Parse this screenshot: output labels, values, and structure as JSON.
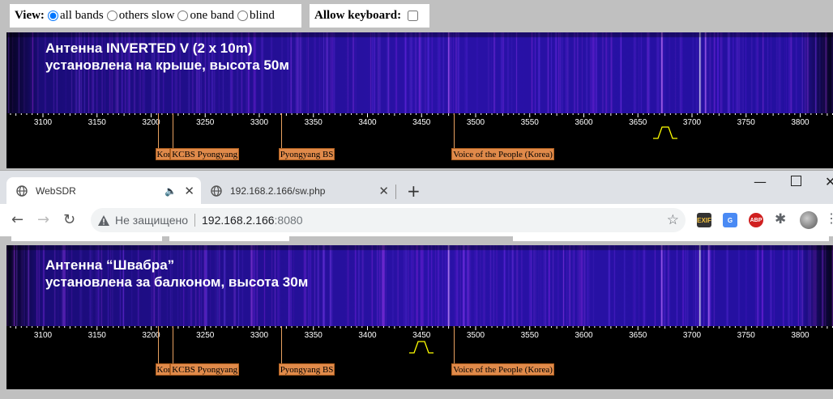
{
  "controls": {
    "view_label": "View:",
    "options": [
      "all bands",
      "others slow",
      "one band",
      "blind"
    ],
    "selected": "all bands",
    "keyboard_label": "Allow keyboard:",
    "keyboard_checked": false
  },
  "panels": [
    {
      "title_line1": "Антенна INVERTED V (2 x 10m)",
      "title_line2": "установлена на крыше, высота 50м",
      "passband_khz": 3675
    },
    {
      "title_line1": "Антенна “Швабра”",
      "title_line2": "установлена за балконом, высота 30м",
      "passband_khz": 3450
    }
  ],
  "scale": {
    "ticks": [
      "3100",
      "3150",
      "3200",
      "3250",
      "3300",
      "3350",
      "3400",
      "3450",
      "3500",
      "3550",
      "3600",
      "3650",
      "3700",
      "3750",
      "3800"
    ]
  },
  "stations": [
    {
      "label": "Kor",
      "khz": 3206
    },
    {
      "label": "KCBS Pyongyang",
      "khz": 3220
    },
    {
      "label": "Pyongyang BS",
      "khz": 3320
    },
    {
      "label": "Voice of the People (Korea)",
      "khz": 3480
    }
  ],
  "browser": {
    "tabs": [
      {
        "title": "WebSDR",
        "active": true
      },
      {
        "title": "192.168.2.166/sw.php",
        "active": false
      }
    ],
    "new_tab": "+",
    "security_text": "Не защищено",
    "url_host": "192.168.2.166",
    "url_port": ":8080",
    "extensions": [
      "EXIF",
      "G",
      "ABP"
    ]
  },
  "colors": {
    "waterfall_bg": "#2a10a0",
    "station_fill": "#e08a4a",
    "passband": "#ffff00"
  }
}
